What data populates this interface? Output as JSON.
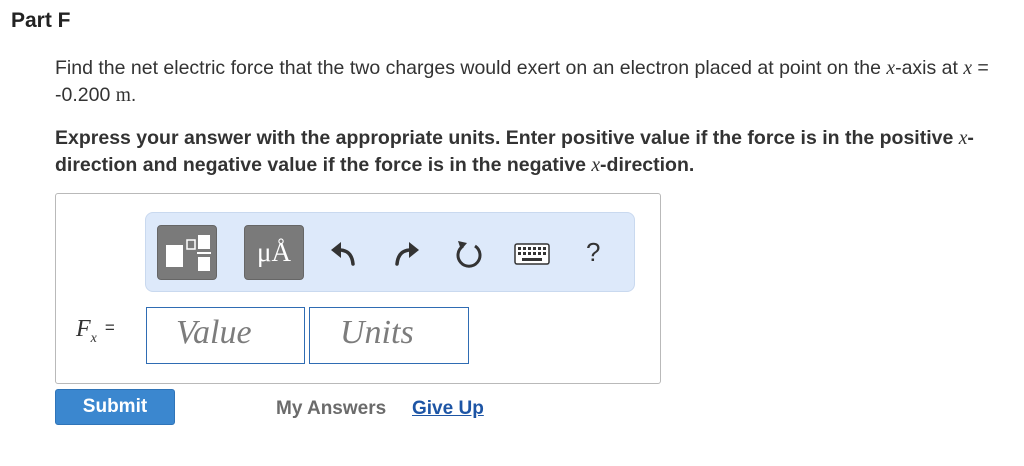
{
  "part": {
    "title": "Part F"
  },
  "question": {
    "text_1": "Find the net electric force that the two charges would exert on an electron placed at point on the ",
    "var_x": "x",
    "text_2": "-axis at ",
    "var_x2": "x",
    "text_3": " = -0.200 ",
    "unit_m": "m",
    "text_4": "."
  },
  "instructions": {
    "text_1": "Express your answer with the appropriate units. Enter positive value if the force is in the positive ",
    "var_x": "x",
    "text_2": "-direction and negative value if the force is in the negative ",
    "var_x2": "x",
    "text_3": "-direction."
  },
  "toolbar": {
    "units_label": "μÅ",
    "help_label": "?",
    "icons": [
      "templates-icon",
      "undo-icon",
      "redo-icon",
      "reset-icon",
      "keyboard-icon",
      "help-icon"
    ]
  },
  "answer": {
    "label_var": "F",
    "label_sub": "x",
    "label_eq": "=",
    "value_placeholder": "Value",
    "units_placeholder": "Units"
  },
  "actions": {
    "submit_label": "Submit",
    "my_answers_label": "My Answers",
    "give_up_label": "Give Up"
  },
  "colors": {
    "accent": "#3b87cf",
    "link": "#1d55a5",
    "toolbar_bg": "#dde9fa",
    "input_border": "#2f6cb3"
  }
}
